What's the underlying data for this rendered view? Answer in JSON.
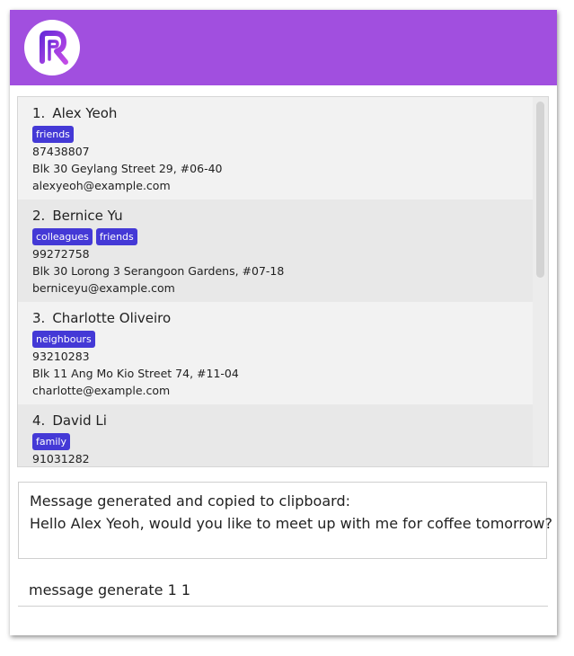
{
  "app": {
    "logo_icon": "r-logo-icon",
    "header_color": "#a14fdf",
    "tag_color": "#4439d6"
  },
  "persons": [
    {
      "index": "1.",
      "name": "Alex Yeoh",
      "tags": [
        "friends"
      ],
      "phone": "87438807",
      "address": "Blk 30 Geylang Street 29, #06-40",
      "email": "alexyeoh@example.com"
    },
    {
      "index": "2.",
      "name": "Bernice Yu",
      "tags": [
        "colleagues",
        "friends"
      ],
      "phone": "99272758",
      "address": "Blk 30 Lorong 3 Serangoon Gardens, #07-18",
      "email": "berniceyu@example.com"
    },
    {
      "index": "3.",
      "name": "Charlotte Oliveiro",
      "tags": [
        "neighbours"
      ],
      "phone": "93210283",
      "address": "Blk 11 Ang Mo Kio Street 74, #11-04",
      "email": "charlotte@example.com"
    },
    {
      "index": "4.",
      "name": "David Li",
      "tags": [
        "family"
      ],
      "phone": "91031282",
      "address": "",
      "email": ""
    }
  ],
  "result": {
    "line1": "Message generated and copied to clipboard:",
    "line2": "Hello Alex Yeoh, would you like to meet up with me for coffee tomorrow?"
  },
  "command": {
    "value": "message generate 1 1"
  }
}
